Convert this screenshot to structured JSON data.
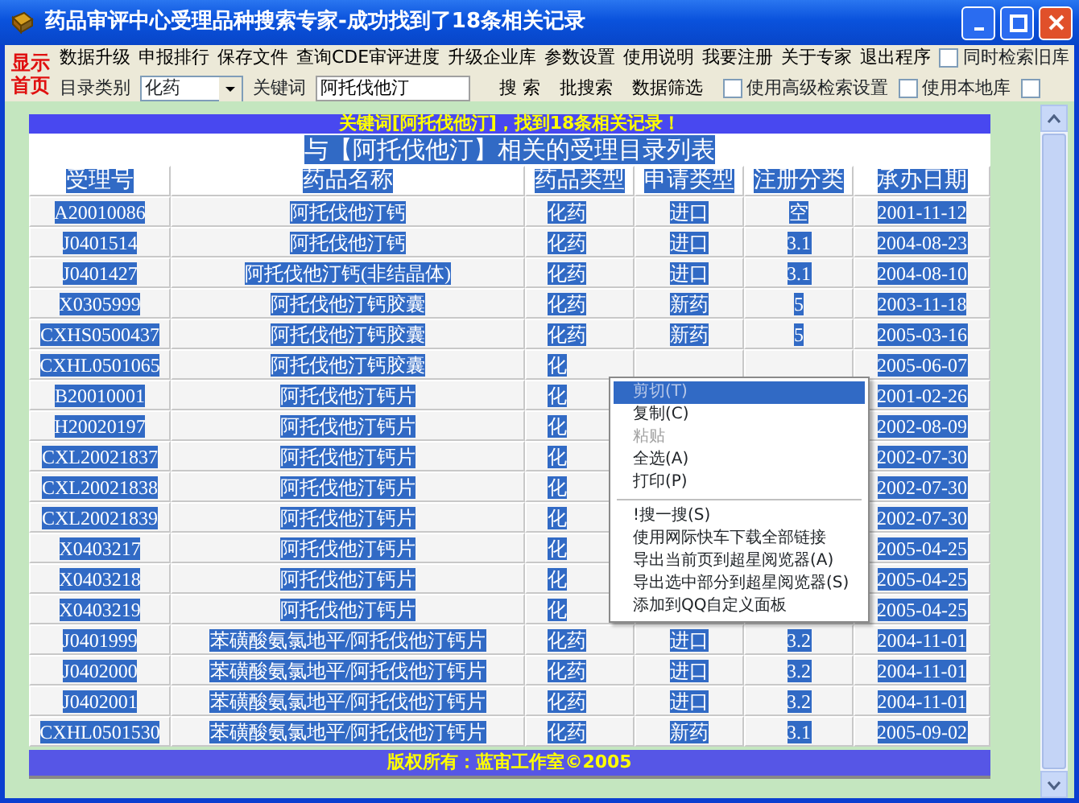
{
  "window": {
    "title": "药品审评中心受理品种搜索专家-成功找到了18条相关记录"
  },
  "toolbar": {
    "logo": [
      "显示",
      "首页"
    ],
    "menu": [
      "数据升级",
      "申报排行",
      "保存文件",
      "查询CDE审评进度",
      "升级企业库",
      "参数设置",
      "使用说明",
      "我要注册",
      "关于专家",
      "退出程序"
    ],
    "old_db": {
      "label": "同时检索旧库",
      "checked": false
    },
    "category_label": "目录类别",
    "category": {
      "value": "化药"
    },
    "keyword_label": "关键词",
    "keyword": {
      "value": "阿托伐他汀"
    },
    "actions": [
      "搜 索",
      "批搜索",
      "数据筛选"
    ],
    "options": [
      {
        "label": "使用高级检索设置",
        "checked": false
      },
      {
        "label": "使用本地库",
        "checked": false
      }
    ],
    "end_checkbox": {
      "checked": false
    }
  },
  "results": {
    "banner": "关键词[阿托伐他汀]，找到18条相关记录！",
    "heading": "与【阿托伐他汀】相关的受理目录列表",
    "columns": [
      "受理号",
      "药品名称",
      "药品类型",
      "申请类型",
      "注册分类",
      "承办日期"
    ],
    "rows": [
      [
        "A20010086",
        "阿托伐他汀钙",
        "化药",
        "进口",
        "空",
        "2001-11-12"
      ],
      [
        "J0401514",
        "阿托伐他汀钙",
        "化药",
        "进口",
        "3.1",
        "2004-08-23"
      ],
      [
        "J0401427",
        "阿托伐他汀钙(非结晶体)",
        "化药",
        "进口",
        "3.1",
        "2004-08-10"
      ],
      [
        "X0305999",
        "阿托伐他汀钙胶囊",
        "化药",
        "新药",
        "5",
        "2003-11-18"
      ],
      [
        "CXHS0500437",
        "阿托伐他汀钙胶囊",
        "化药",
        "新药",
        "5",
        "2005-03-16"
      ],
      [
        "CXHL0501065",
        "阿托伐他汀钙胶囊",
        "化",
        null,
        null,
        "2005-06-07"
      ],
      [
        "B20010001",
        "阿托伐他汀钙片",
        "化",
        null,
        null,
        "2001-02-26"
      ],
      [
        "H20020197",
        "阿托伐他汀钙片",
        "化",
        null,
        null,
        "2002-08-09"
      ],
      [
        "CXL20021837",
        "阿托伐他汀钙片",
        "化",
        null,
        null,
        "2002-07-30"
      ],
      [
        "CXL20021838",
        "阿托伐他汀钙片",
        "化",
        null,
        null,
        "2002-07-30"
      ],
      [
        "CXL20021839",
        "阿托伐他汀钙片",
        "化",
        null,
        null,
        "2002-07-30"
      ],
      [
        "X0403217",
        "阿托伐他汀钙片",
        "化",
        null,
        null,
        "2005-04-25"
      ],
      [
        "X0403218",
        "阿托伐他汀钙片",
        "化",
        null,
        null,
        "2005-04-25"
      ],
      [
        "X0403219",
        "阿托伐他汀钙片",
        "化",
        null,
        null,
        "2005-04-25"
      ],
      [
        "J0401999",
        "苯磺酸氨氯地平/阿托伐他汀钙片",
        "化药",
        "进口",
        "3.2",
        "2004-11-01"
      ],
      [
        "J0402000",
        "苯磺酸氨氯地平/阿托伐他汀钙片",
        "化药",
        "进口",
        "3.2",
        "2004-11-01"
      ],
      [
        "J0402001",
        "苯磺酸氨氯地平/阿托伐他汀钙片",
        "化药",
        "进口",
        "3.2",
        "2004-11-01"
      ],
      [
        "CXHL0501530",
        "苯磺酸氨氯地平/阿托伐他汀钙片",
        "化药",
        "新药",
        "3.1",
        "2005-09-02"
      ]
    ],
    "footer": "版权所有：蓝宙工作室©2005"
  },
  "context_menu": {
    "items": [
      {
        "kind": "item",
        "label": "剪切(T)",
        "disabled": true,
        "selected": true
      },
      {
        "kind": "item",
        "label": "复制(C)",
        "disabled": false,
        "selected": false
      },
      {
        "kind": "item",
        "label": "粘贴",
        "disabled": true,
        "selected": false
      },
      {
        "kind": "item",
        "label": "全选(A)",
        "disabled": false,
        "selected": false
      },
      {
        "kind": "item",
        "label": "打印(P)",
        "disabled": false,
        "selected": false
      },
      {
        "kind": "separator"
      },
      {
        "kind": "item",
        "label": "!搜一搜(S)",
        "disabled": false,
        "selected": false
      },
      {
        "kind": "item",
        "label": "使用网际快车下载全部链接",
        "disabled": false,
        "selected": false
      },
      {
        "kind": "item",
        "label": "导出当前页到超星阅览器(A)",
        "disabled": false,
        "selected": false
      },
      {
        "kind": "item",
        "label": "导出选中部分到超星阅览器(S)",
        "disabled": false,
        "selected": false
      },
      {
        "kind": "item",
        "label": "添加到QQ自定义面板",
        "disabled": false,
        "selected": false
      }
    ]
  }
}
